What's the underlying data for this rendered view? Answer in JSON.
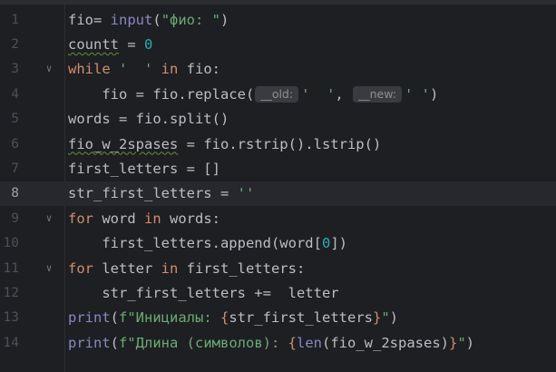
{
  "lines": [
    {
      "no": "1",
      "fold": false,
      "current": false
    },
    {
      "no": "2",
      "fold": false,
      "current": false
    },
    {
      "no": "3",
      "fold": true,
      "current": false
    },
    {
      "no": "4",
      "fold": false,
      "current": false
    },
    {
      "no": "5",
      "fold": false,
      "current": false
    },
    {
      "no": "6",
      "fold": false,
      "current": false
    },
    {
      "no": "7",
      "fold": false,
      "current": false
    },
    {
      "no": "8",
      "fold": false,
      "current": true
    },
    {
      "no": "9",
      "fold": true,
      "current": false
    },
    {
      "no": "10",
      "fold": false,
      "current": false
    },
    {
      "no": "11",
      "fold": true,
      "current": false
    },
    {
      "no": "12",
      "fold": false,
      "current": false
    },
    {
      "no": "13",
      "fold": false,
      "current": false
    },
    {
      "no": "14",
      "fold": false,
      "current": false
    }
  ],
  "code": {
    "l1": {
      "a": "fio= ",
      "b": "input",
      "c": "(",
      "d": "\"фио: \"",
      "e": ")"
    },
    "l2": {
      "a": "countt",
      "b": " = ",
      "c": "0"
    },
    "l3": {
      "a": "while ",
      "b": "'  '",
      "c": " in ",
      "d": "fio:"
    },
    "l4": {
      "indent": "    ",
      "a": "fio = fio.replace(",
      "h1": "__old:",
      "b": "'  '",
      ",": ", ",
      "h2": "__new:",
      "c": "' '",
      "d": ")"
    },
    "l5": {
      "a": "words = fio.split()"
    },
    "l6": {
      "a": "fio_w_2spases",
      "b": " = fio.rstrip().lstrip()"
    },
    "l7": {
      "a": "first_letters = []"
    },
    "l8": {
      "a": "str_first_letters = ",
      "b": "''"
    },
    "l9": {
      "a": "for ",
      "b": "word ",
      "c": "in ",
      "d": "words:"
    },
    "l10": {
      "indent": "    ",
      "a": "first_letters.append(word[",
      "b": "0",
      "c": "])"
    },
    "l11": {
      "a": "for ",
      "b": "letter ",
      "c": "in ",
      "d": "first_letters:"
    },
    "l12": {
      "indent": "    ",
      "a": "str_first_letters +=  letter"
    },
    "l13": {
      "a": "print",
      "b": "(",
      "c": "f\"Инициалы: ",
      "d": "{",
      "e": "str_first_letters",
      "f": "}",
      "g": "\"",
      "h": ")"
    },
    "l14": {
      "a": "print",
      "b": "(",
      "c": "f\"Длина (символов): ",
      "d": "{",
      "e": "len",
      "f": "(fio_w_2spases)",
      "g": "}",
      "h": "\"",
      "i": ")"
    }
  },
  "icons": {
    "fold": "chevron-down-icon"
  },
  "colors": {
    "background": "#1e1f22",
    "keyword": "#cf8e6d",
    "string": "#6aab73",
    "number": "#2aacb8",
    "builtin": "#8888c6",
    "text": "#bcbec4"
  }
}
